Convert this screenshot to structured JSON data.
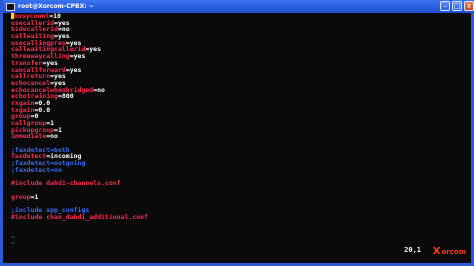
{
  "window": {
    "title": "root@Xorcom-CPBX: ~",
    "brand_color": "#2b5bd6",
    "buttons": [
      "–",
      "□",
      "x"
    ]
  },
  "editor": {
    "lines": [
      {
        "type": "kv",
        "key": "busycount",
        "sep": "=",
        "val": "10",
        "cursor": true
      },
      {
        "type": "kv",
        "key": "usecallerid",
        "sep": "=",
        "val": "yes"
      },
      {
        "type": "kv",
        "key": "hidecallerid",
        "sep": "=",
        "val": "no"
      },
      {
        "type": "kv",
        "key": "callwaiting",
        "sep": "=",
        "val": "yes"
      },
      {
        "type": "kv",
        "key": "usecallingpres",
        "sep": "=",
        "val": "yes"
      },
      {
        "type": "kv",
        "key": "callwaitingcallerid",
        "sep": "=",
        "val": "yes"
      },
      {
        "type": "kv",
        "key": "threewaycalling",
        "sep": "=",
        "val": "yes"
      },
      {
        "type": "kv",
        "key": "transfer",
        "sep": "=",
        "val": "yes"
      },
      {
        "type": "kv",
        "key": "cancallforward",
        "sep": "=",
        "val": "yes"
      },
      {
        "type": "kv",
        "key": "callreturn",
        "sep": "=",
        "val": "yes"
      },
      {
        "type": "kv",
        "key": "echocancel",
        "sep": "=",
        "val": "yes"
      },
      {
        "type": "kv",
        "key": "echocancelwhenbridged",
        "sep": "=",
        "val": "no"
      },
      {
        "type": "kv",
        "key": "echotraining",
        "sep": "=",
        "val": "800"
      },
      {
        "type": "kv",
        "key": "rxgain",
        "sep": "=",
        "val": "0.0"
      },
      {
        "type": "kv",
        "key": "txgain",
        "sep": "=",
        "val": "0.0"
      },
      {
        "type": "kv",
        "key": "group",
        "sep": "=",
        "val": "0"
      },
      {
        "type": "kv",
        "key": "callgroup",
        "sep": "=",
        "val": "1"
      },
      {
        "type": "kv",
        "key": "pickupgroup",
        "sep": "=",
        "val": "1"
      },
      {
        "type": "kv",
        "key": "immediate",
        "sep": "=",
        "val": "no"
      },
      {
        "type": "blank"
      },
      {
        "type": "comment",
        "text": ";faxdetect=both"
      },
      {
        "type": "kv",
        "key": "faxdetect",
        "sep": "=",
        "val": "incoming"
      },
      {
        "type": "comment",
        "text": ";faxdetect=outgoing"
      },
      {
        "type": "comment",
        "text": ";faxdetect=no"
      },
      {
        "type": "blank"
      },
      {
        "type": "directive",
        "text": "#include dahdi-channels.conf"
      },
      {
        "type": "blank"
      },
      {
        "type": "kv",
        "key": "group",
        "sep": "=",
        "val": "1"
      },
      {
        "type": "blank"
      },
      {
        "type": "comment",
        "text": ";include xpp_configs"
      },
      {
        "type": "directive",
        "text": "#include chan_dahdi_additional.conf"
      },
      {
        "type": "blank"
      },
      {
        "type": "blank"
      },
      {
        "type": "tilde",
        "text": "~"
      },
      {
        "type": "tilde",
        "text": "~"
      }
    ],
    "cursor_position": "20,1"
  },
  "logo": {
    "mark": "X",
    "text": "orcom",
    "accent": "#ff3b1e"
  }
}
